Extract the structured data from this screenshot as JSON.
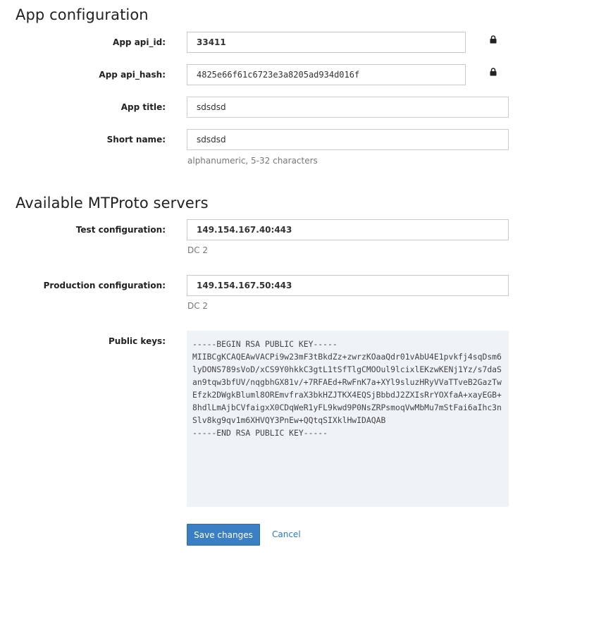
{
  "app_config": {
    "title": "App configuration",
    "api_id": {
      "label": "App api_id:",
      "value": "33411",
      "icon": "lock-icon"
    },
    "api_hash": {
      "label": "App api_hash:",
      "value": "4825e66f61c6723e3a8205ad934d016f",
      "icon": "lock-icon"
    },
    "app_title": {
      "label": "App title:",
      "value": "sdsdsd"
    },
    "short_name": {
      "label": "Short name:",
      "value": "sdsdsd",
      "hint": "alphanumeric, 5-32 characters"
    }
  },
  "servers": {
    "title": "Available MTProto servers",
    "test": {
      "label": "Test configuration:",
      "value": "149.154.167.40:443",
      "dc": "DC 2"
    },
    "production": {
      "label": "Production configuration:",
      "value": "149.154.167.50:443",
      "dc": "DC 2"
    },
    "public_keys": {
      "label": "Public keys:",
      "value": "-----BEGIN RSA PUBLIC KEY-----\nMIIBCgKCAQEAwVACPi9w23mF3tBkdZz+zwrzKOaaQdr01vAbU4E1pvkfj4sqDsm6\nlyDONS789sVoD/xCS9Y0hkkC3gtL1tSfTlgCMOOul9lcixlEKzwKENj1Yz/s7daS\nan9tqw3bfUV/nqgbhGX81v/+7RFAEd+RwFnK7a+XYl9sluzHRyVVaTTveB2GazTw\nEfzk2DWgkBluml8OREmvfraX3bkHZJTKX4EQSjBbbdJ2ZXIsRrYOXfaA+xayEGB+\n8hdlLmAjbCVfaigxX0CDqWeR1yFL9kwd9P0NsZRPsmoqVwMbMu7mStFai6aIhc3n\nSlv8kg9qv1m6XHVQY3PnEw+QQtqSIXklHwIDAQAB\n-----END RSA PUBLIC KEY-----"
    }
  },
  "actions": {
    "save_label": "Save changes",
    "cancel_label": "Cancel"
  },
  "colors": {
    "primary": "#3a7fc4",
    "link": "#2a7ab8",
    "keys_background": "#eef3f7"
  }
}
